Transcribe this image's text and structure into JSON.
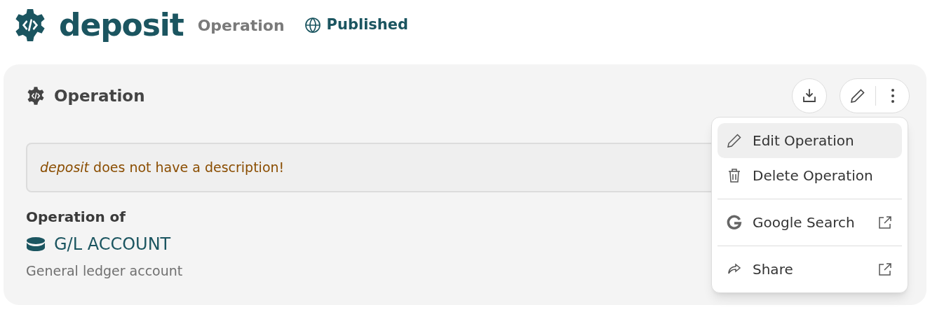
{
  "header": {
    "title": "deposit",
    "type_label": "Operation",
    "status": "Published"
  },
  "card": {
    "title": "Operation",
    "description_notice": "*deposit* does not have a description!",
    "section_label": "Operation of",
    "link": {
      "label": "G/L ACCOUNT",
      "description": "General ledger account"
    }
  },
  "menu": {
    "groups": [
      [
        {
          "kind": "edit",
          "label": "Edit Operation",
          "highlighted": true,
          "external": false
        },
        {
          "kind": "delete",
          "label": "Delete Operation",
          "highlighted": false,
          "external": false
        }
      ],
      [
        {
          "kind": "search",
          "label": "Google Search",
          "highlighted": false,
          "external": true
        }
      ],
      [
        {
          "kind": "share",
          "label": "Share",
          "highlighted": false,
          "external": true
        }
      ]
    ]
  }
}
